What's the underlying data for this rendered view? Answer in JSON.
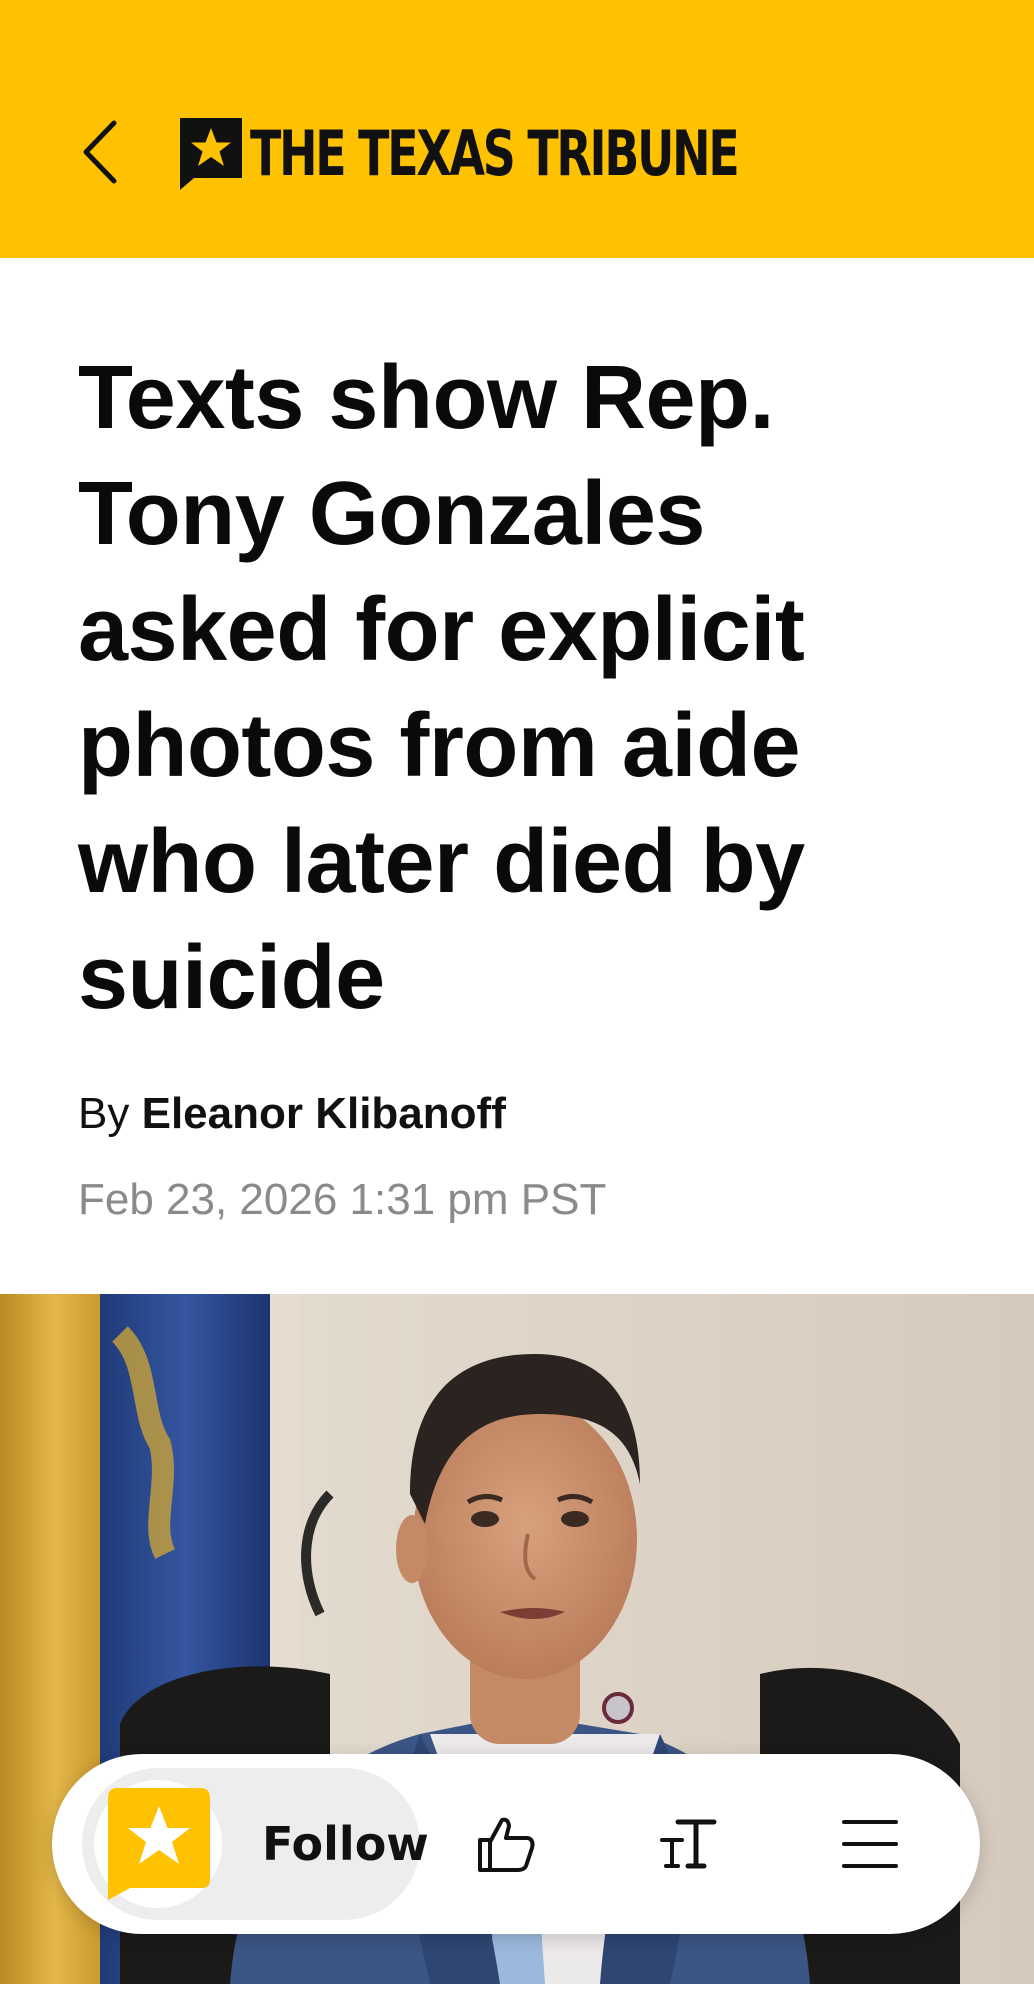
{
  "header": {
    "back_icon": "chevron-left-icon",
    "brand_name": "THE TEXAS TRIBUNE",
    "brand_color": "#FFC200"
  },
  "article": {
    "headline": "Texts show Rep. Tony Gonzales asked for explicit photos from aide who later died by suicide",
    "byline_prefix": "By",
    "author": "Eleanor Klibanoff",
    "date": "Feb 23, 2026 1:31 pm PST"
  },
  "toolbar": {
    "follow_label": "Follow",
    "like_icon": "thumbs-up-icon",
    "text_size_icon": "text-size-icon",
    "menu_icon": "menu-icon"
  }
}
